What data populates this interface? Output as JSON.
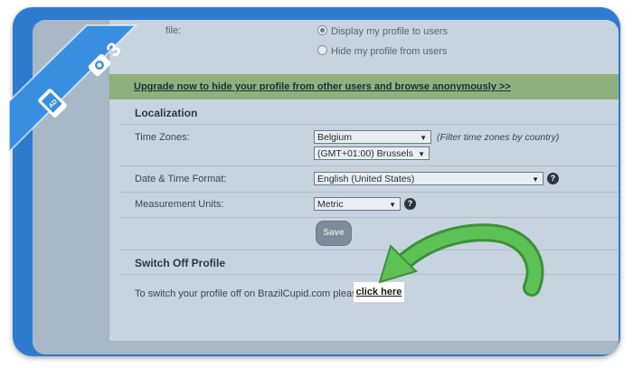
{
  "visibility": {
    "label_fragment": "file:",
    "options": [
      {
        "label": "Display my profile to users",
        "selected": true
      },
      {
        "label": "Hide my profile from users",
        "selected": false
      }
    ]
  },
  "upgrade": {
    "link": "Upgrade now to hide your profile from other users and browse anonymously >>"
  },
  "localization": {
    "title": "Localization",
    "time_zones": {
      "label": "Time Zones:",
      "country": "Belgium",
      "zone": "(GMT+01:00) Brussels",
      "hint": "(Filter time zones by country)"
    },
    "date_format": {
      "label": "Date & Time Format:",
      "value": "English (United States)",
      "help": "?"
    },
    "units": {
      "label": "Measurement Units:",
      "value": "Metric",
      "help": "?"
    },
    "save_label": "Save"
  },
  "switch_off": {
    "title": "Switch Off Profile",
    "text": "To switch your profile off on BrazilCupid.com please",
    "link": "click here"
  },
  "badge": {
    "step": "3",
    "icons": [
      "camera-icon",
      "phone-icon"
    ]
  },
  "colors": {
    "frame_blue": "#2f7bd0",
    "arrow_green": "#4fb34a",
    "upgrade_green": "#8fb07c"
  }
}
